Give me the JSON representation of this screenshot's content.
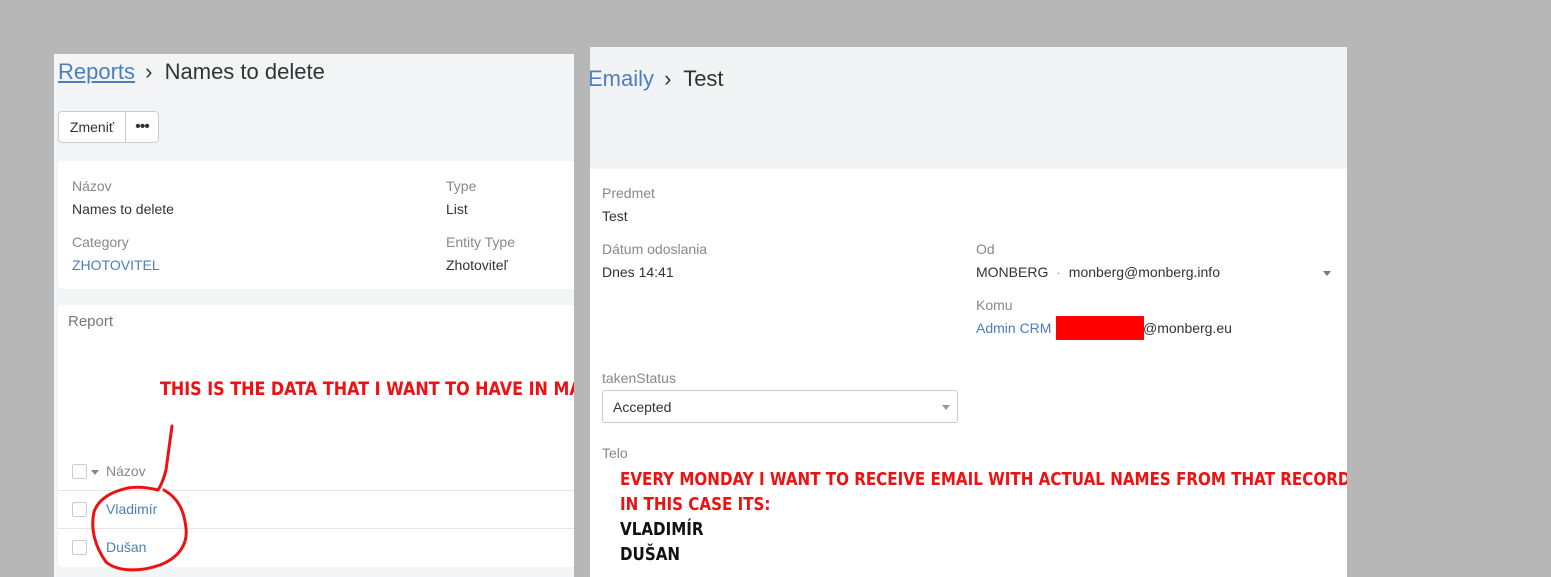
{
  "left": {
    "breadcrumb": {
      "root": "Reports",
      "separator": "›",
      "current": "Names to delete"
    },
    "toolbar": {
      "edit_label": "Zmeniť",
      "more_label": "•••"
    },
    "details": {
      "name_label": "Názov",
      "name_value": "Names to delete",
      "type_label": "Type",
      "type_value": "List",
      "category_label": "Category",
      "category_value": "ZHOTOVITEL",
      "entity_type_label": "Entity Type",
      "entity_type_value": "Zhotoviteľ"
    },
    "report": {
      "title": "Report",
      "annotation": "THIS IS THE DATA THAT I WANT TO HAVE IN MAIL",
      "column_header": "Názov",
      "rows": [
        "Vladimír",
        "Dušan"
      ]
    }
  },
  "right": {
    "breadcrumb": {
      "root": "Emaily",
      "separator": "›",
      "current": "Test"
    },
    "fields": {
      "subject_label": "Predmet",
      "subject_value": "Test",
      "sent_label": "Dátum odoslania",
      "sent_value": "Dnes 14:41",
      "from_label": "Od",
      "from_name": "MONBERG",
      "from_dot": "·",
      "from_email": "monberg@monberg.info",
      "to_label": "Komu",
      "to_name": "Admin CRM",
      "to_email_suffix": "@monberg.eu",
      "status_label": "takenStatus",
      "status_value": "Accepted",
      "body_label": "Telo"
    },
    "annotation": {
      "line1": "EVERY MONDAY I WANT TO RECEIVE EMAIL WITH ACTUAL NAMES FROM THAT RECORD",
      "line2": "IN THIS CASE ITS:",
      "line3": "VLADIMÍR",
      "line4": "DUŠAN"
    }
  },
  "colors": {
    "link": "#4b7fbd",
    "annotation": "#ee1111",
    "redaction": "#ff0000",
    "backdrop": "#b7b7b7"
  }
}
